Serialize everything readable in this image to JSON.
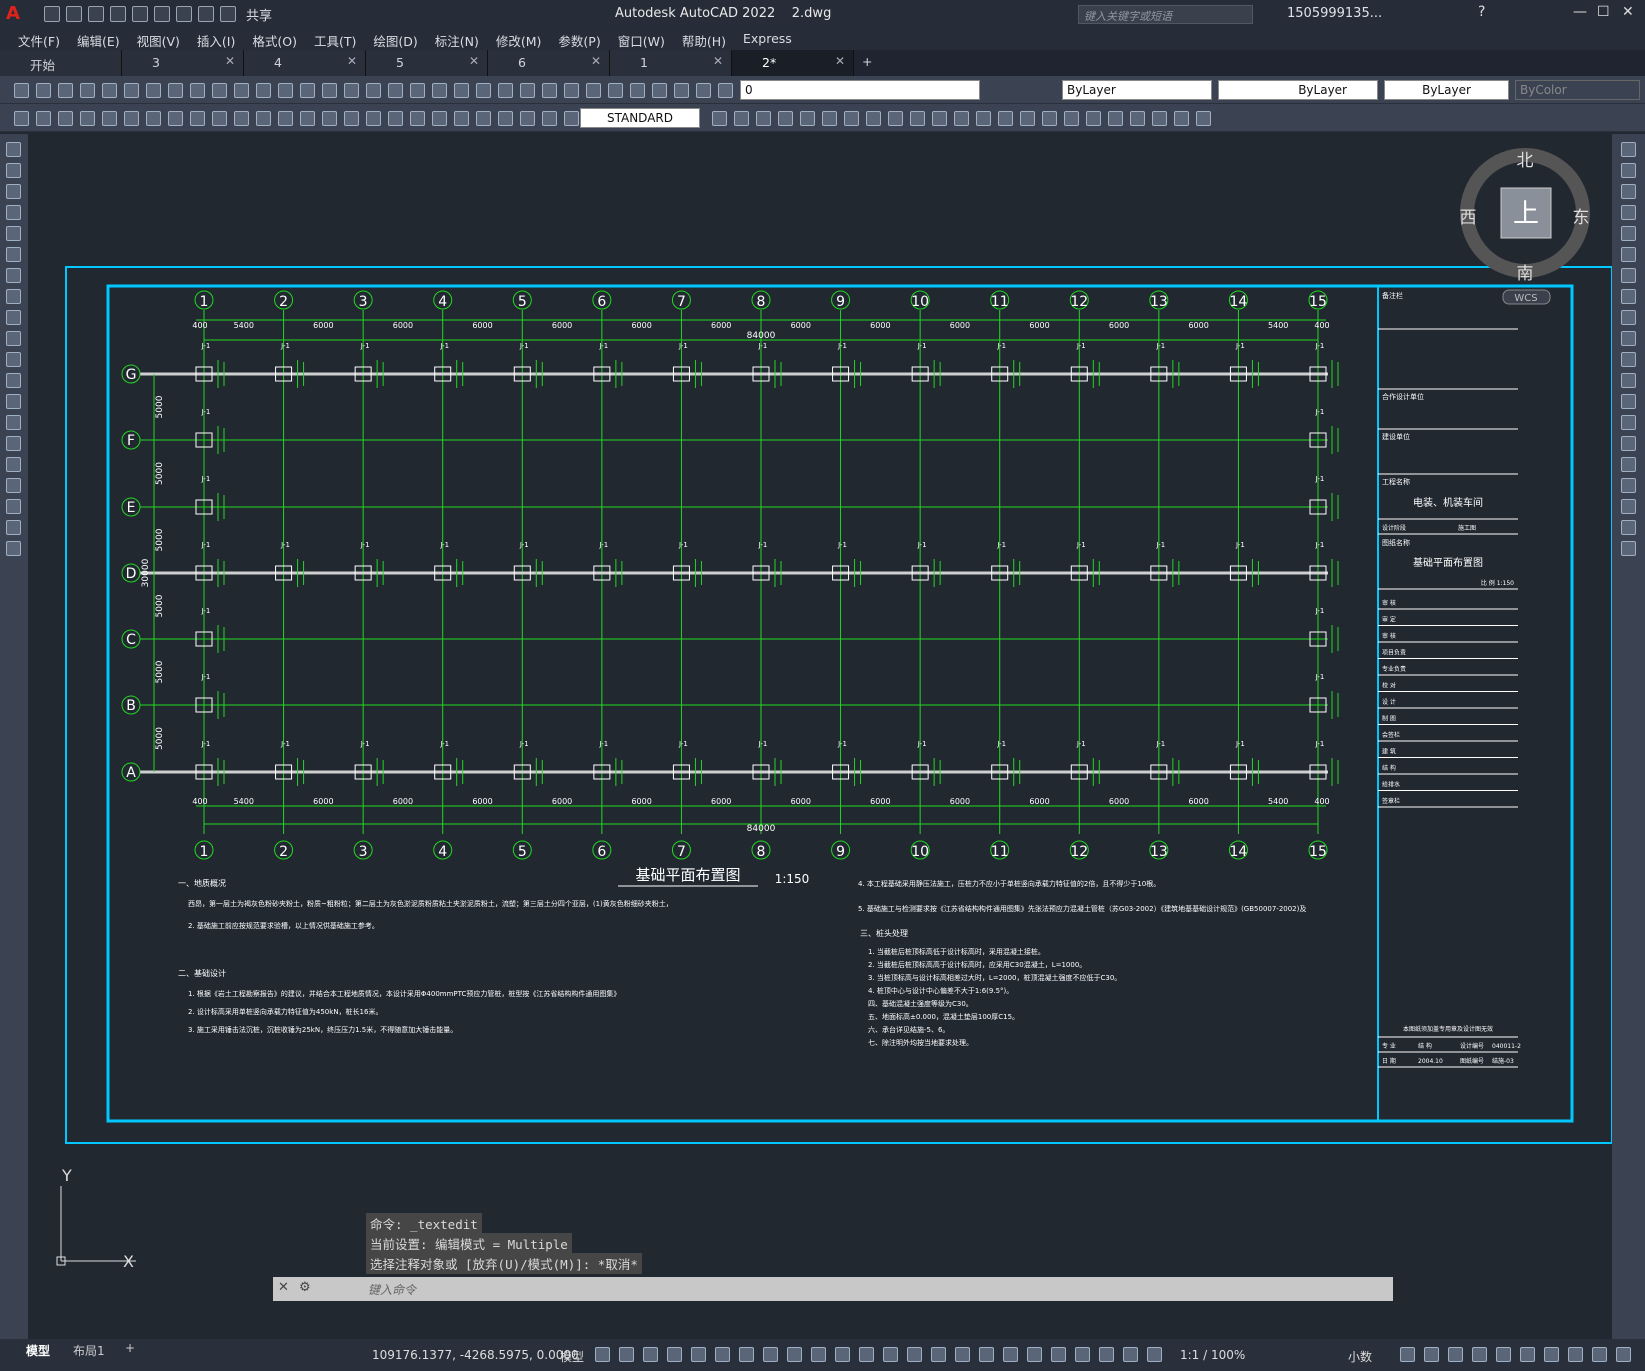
{
  "app": {
    "title": "Autodesk AutoCAD 2022    2.dwg",
    "share": "共享",
    "search_placeholder": "键入关键字或短语",
    "user": "1505999135..."
  },
  "menu": [
    "文件(F)",
    "编辑(E)",
    "视图(V)",
    "插入(I)",
    "格式(O)",
    "工具(T)",
    "绘图(D)",
    "标注(N)",
    "修改(M)",
    "参数(P)",
    "窗口(W)",
    "帮助(H)",
    "Express"
  ],
  "tabs": [
    "开始",
    "3",
    "4",
    "5",
    "6",
    "1",
    "2*"
  ],
  "toolbar": {
    "layer": "0",
    "color": "ByLayer",
    "linetype": "ByLayer",
    "lineweight": "ByLayer",
    "plotstyle": "ByColor",
    "textstyle": "STANDARD"
  },
  "viewcube": {
    "north": "北",
    "south": "南",
    "east": "东",
    "west": "西",
    "face": "上",
    "wcs": "WCS"
  },
  "drawing": {
    "grid_cols": [
      "1",
      "2",
      "3",
      "4",
      "5",
      "6",
      "7",
      "8",
      "9",
      "10",
      "11",
      "12",
      "13",
      "14",
      "15"
    ],
    "grid_rows": [
      "G",
      "F",
      "E",
      "D",
      "C",
      "B",
      "A"
    ],
    "total_width": "84000",
    "bay_dims": [
      "400",
      "5400",
      "6000",
      "6000",
      "6000",
      "6000",
      "6000",
      "6000",
      "6000",
      "6000",
      "6000",
      "6000",
      "6000",
      "6000",
      "5400",
      "400"
    ],
    "row_dims": [
      "5000",
      "5000",
      "5000",
      "5000",
      "5000",
      "5000"
    ],
    "total_depth": "30000",
    "plan_title": "基础平面布置图",
    "plan_scale": "1:150",
    "notes_left_heading1": "一、地质概况",
    "notes_left_heading2": "二、基础设计",
    "notes_right_heading": "三、桩头处理",
    "notes_left": [
      "西昂，第一层土为褐灰色粉砂夹粉土，粉质~粗粉粒；第二层土为灰色淤泥质粉质粘土夹淤泥质粉土，流塑；第三层土分四个亚层，(1)黄灰色粉细砂夹粉土，",
      "2. 基础施工前应按规范要求验槽，以上情况供基础施工参考。",
      "1. 根据《岩土工程勘察报告》的建议，并结合本工程地质情况，本设计采用Φ400mmPTC预应力管桩，桩型按《江苏省结构构件通用图集》",
      "2. 设计标高采用单桩竖向承载力特征值为450kN，桩长16米。",
      "3. 施工采用锤击法沉桩，沉桩收锤为25kN，终压压力1.5米，不得随意加大锤击能量。"
    ],
    "notes_right": [
      "4. 本工程基础采用静压法施工，压桩力不应小于单桩竖向承载力特征值的2倍，且不得少于10根。",
      "5. 基础施工与检测要求按《江苏省结构构件通用图集》先张法预应力混凝土管桩（苏G03-2002）《建筑地基基础设计规范》(GB50007-2002)及",
      "1. 当截桩后桩顶标高低于设计标高时，采用混凝土接桩。",
      "2. 当截桩后桩顶标高高于设计标高时，应采用C30混凝土，L=1000。",
      "3. 当桩顶标高与设计标高相差过大时，L=2000，桩顶混凝土强度不应低于C30。",
      "4. 桩顶中心与设计中心偏差不大于1:6(9.5°)。",
      "四、基础混凝土强度等级为C30。",
      "五、地面标高±0.000，混凝土垫层100厚C15。",
      "六、承台详见结施-5、6。",
      "七、除注明外均按当地要求处理。"
    ]
  },
  "titleblock": {
    "remark": "备注栏",
    "partner": "合作设计单位",
    "owner": "建设单位",
    "project_label": "工程名称",
    "project": "电装、机装车间",
    "stage_label": "设计阶段",
    "stage": "施工图",
    "drawing_label": "图纸名称",
    "drawing": "基础平面布置图",
    "scale": "比 例  1:150",
    "rows": [
      "审 核",
      "审 定",
      "审 核",
      "项目负责",
      "专业负责",
      "校 对",
      "设 计",
      "制 图",
      "会签栏",
      "建 筑",
      "结 构",
      "给排水",
      "签章栏"
    ],
    "stamp": "本图纸须加盖专用章及设计图无效",
    "spec_label": "专 业",
    "spec": "结 构",
    "no_label": "设计编号",
    "no": "040011-2",
    "date_label": "日 期",
    "date": "2004.10",
    "sheet_label": "图纸编号",
    "sheet": "结施-03"
  },
  "command": {
    "history": [
      "命令: _textedit",
      "当前设置: 编辑模式 = Multiple",
      "选择注释对象或 [放弃(U)/模式(M)]: *取消*"
    ],
    "placeholder": "键入命令"
  },
  "layouts": [
    "模型",
    "布局1"
  ],
  "status": {
    "coords": "109176.1377, -4268.5975, 0.0000",
    "mode": "模型",
    "scale": "1:1 / 100%",
    "units": "小数"
  },
  "colors": {
    "grid_green": "#22d822",
    "cyan": "#00c8ff",
    "white": "#ffffff"
  }
}
